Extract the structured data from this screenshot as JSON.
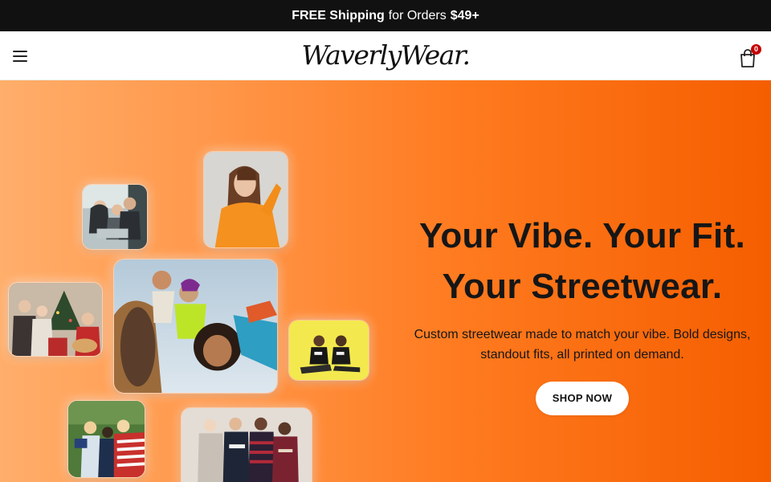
{
  "announcement": {
    "part1": "FREE Shipping",
    "part2": "for Orders",
    "part3": "$49+"
  },
  "header": {
    "logo": "WaverlyWear.",
    "cart_count": "0",
    "icons": [
      "menu-icon",
      "shopping-bag-icon"
    ]
  },
  "hero": {
    "headline_line1": "Your Vibe. Your Fit.",
    "headline_line2": "Your Streetwear.",
    "subtext": "Custom streetwear made to match your vibe. Bold designs, standout fits, all printed on demand.",
    "cta": "SHOP NOW"
  },
  "colors": {
    "announcement_bg": "#111111",
    "hero_gradient_start": "#ffae6b",
    "hero_gradient_end": "#f55e00",
    "cart_badge": "#c40000"
  },
  "photos": [
    "family-photo",
    "woman-orange-sweatshirt-photo",
    "christmas-group-photo",
    "friends-skyward-photo",
    "kids-yellow-photo",
    "friends-flag-photo",
    "group-hoodies-photo"
  ]
}
